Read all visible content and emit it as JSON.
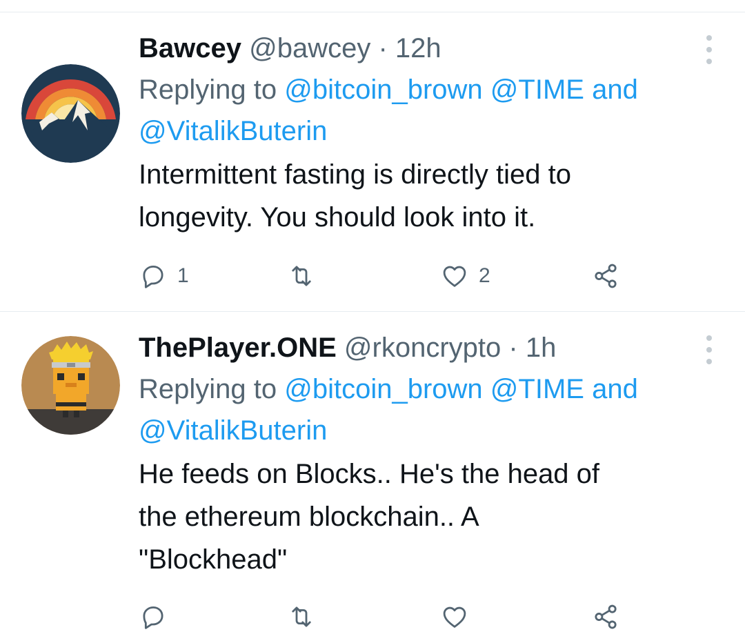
{
  "tweets": [
    {
      "display_name": "Bawcey",
      "handle": "@bawcey",
      "separator": "·",
      "time": "12h",
      "replying_prefix": "Replying to",
      "mention_1": "@bitcoin_brown",
      "mention_2": "@TIME",
      "conjunction": "and",
      "mention_3": "@VitalikButerin",
      "text_line_1": "Intermittent fasting is directly tied to",
      "text_line_2": "longevity. You should look into it.",
      "reply_count": "1",
      "retweet_count": "",
      "like_count": "2",
      "avatar_icon": "mountain-sunset-icon"
    },
    {
      "display_name": "ThePlayer.ONE",
      "handle": "@rkoncrypto",
      "separator": "·",
      "time": "1h",
      "replying_prefix": "Replying to",
      "mention_1": "@bitcoin_brown",
      "mention_2": "@TIME",
      "conjunction": "and",
      "mention_3": "@VitalikButerin",
      "text_line_1": "He feeds on Blocks.. He's the head of",
      "text_line_2": "the ethereum blockchain.. A",
      "text_line_3": "\"Blockhead\"",
      "avatar_icon": "pixel-ninja-icon"
    }
  ],
  "colors": {
    "link": "#1d9bf0",
    "secondary_text": "#536471",
    "primary_text": "#0f1419",
    "divider": "#e6ecf0"
  }
}
